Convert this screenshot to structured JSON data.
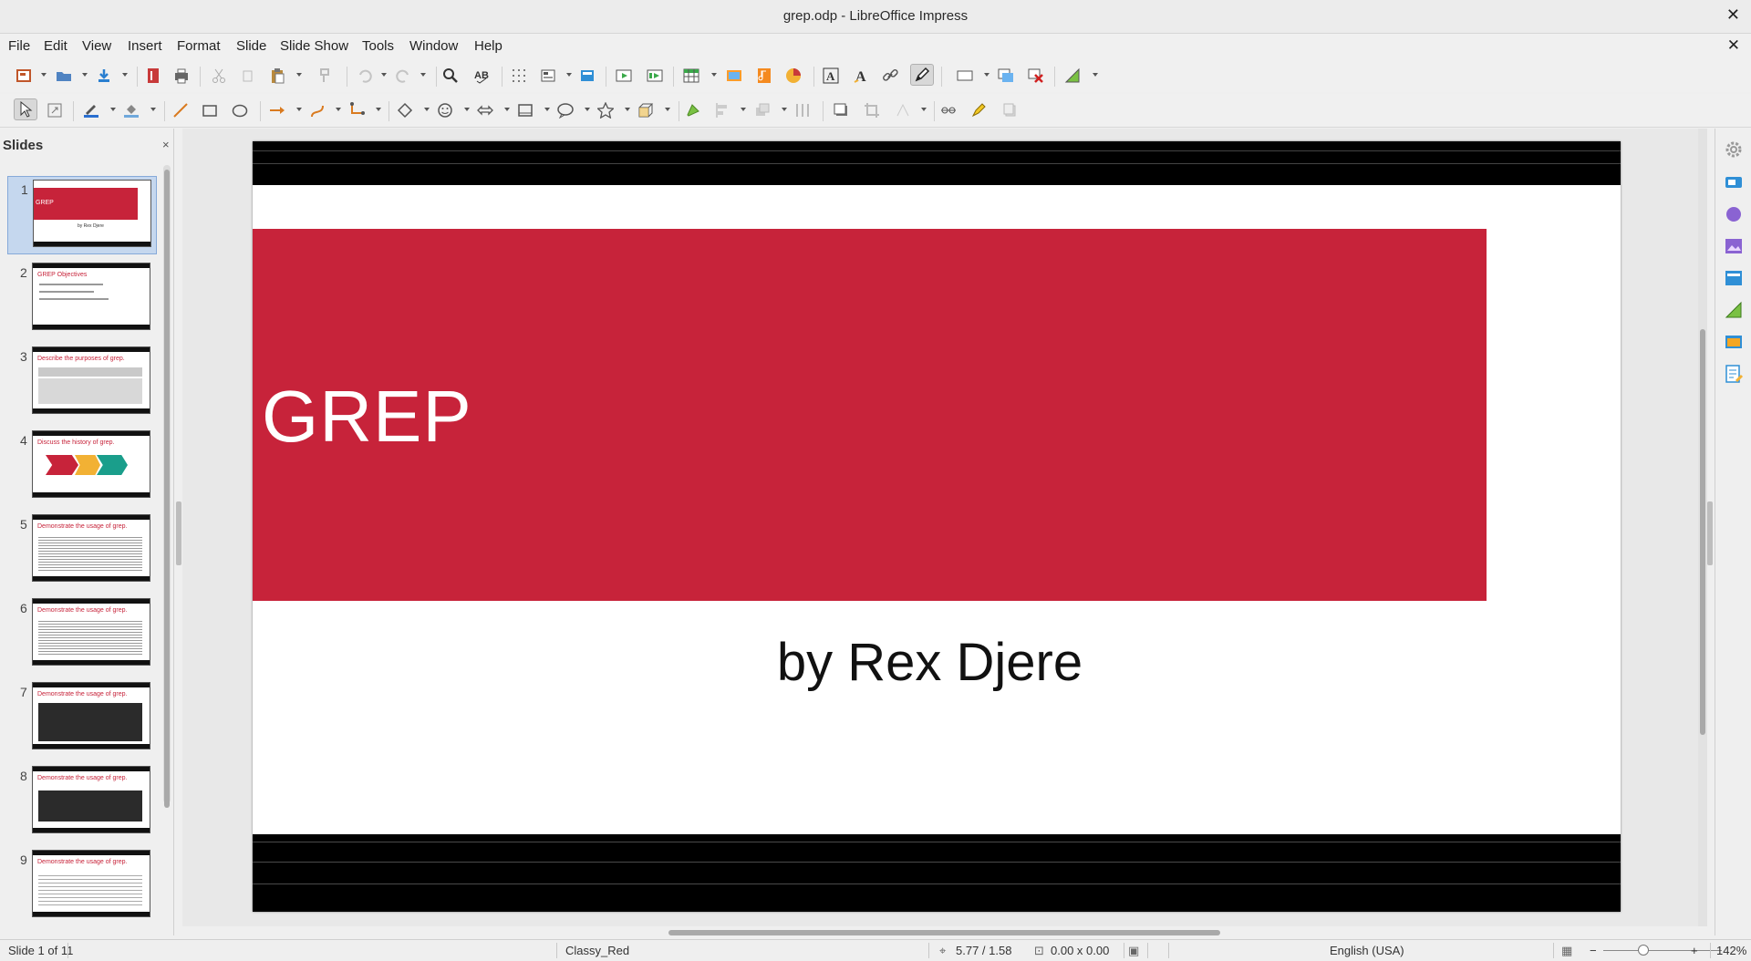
{
  "window": {
    "title": "grep.odp - LibreOffice Impress",
    "close_glyph": "✕"
  },
  "menu": {
    "items": [
      "File",
      "Edit",
      "View",
      "Insert",
      "Format",
      "Slide",
      "Slide Show",
      "Tools",
      "Window",
      "Help"
    ],
    "doc_close_glyph": "✕"
  },
  "slides_pane": {
    "header": "Slides",
    "close_glyph": "×",
    "thumbs": [
      {
        "num": "1",
        "title": "GREP",
        "subtitle": "by Rex Djere"
      },
      {
        "num": "2",
        "title": "GREP Objectives"
      },
      {
        "num": "3",
        "title": "Describe the purposes of grep."
      },
      {
        "num": "4",
        "title": "Discuss the history of grep."
      },
      {
        "num": "5",
        "title": "Demonstrate the usage of grep."
      },
      {
        "num": "6",
        "title": "Demonstrate the usage of grep."
      },
      {
        "num": "7",
        "title": "Demonstrate the usage of grep."
      },
      {
        "num": "8",
        "title": "Demonstrate the usage of grep."
      },
      {
        "num": "9",
        "title": "Demonstrate the usage of grep."
      }
    ]
  },
  "slide": {
    "title": "GREP",
    "subtitle": "by Rex Djere",
    "accent": "#c7233a"
  },
  "statusbar": {
    "slide_of": "Slide 1 of 11",
    "master": "Classy_Red",
    "position": "5.77 / 1.58",
    "size": "0.00 x 0.00",
    "language": "English (USA)",
    "zoom": "142%",
    "zoom_minus": "−",
    "zoom_plus": "+"
  }
}
